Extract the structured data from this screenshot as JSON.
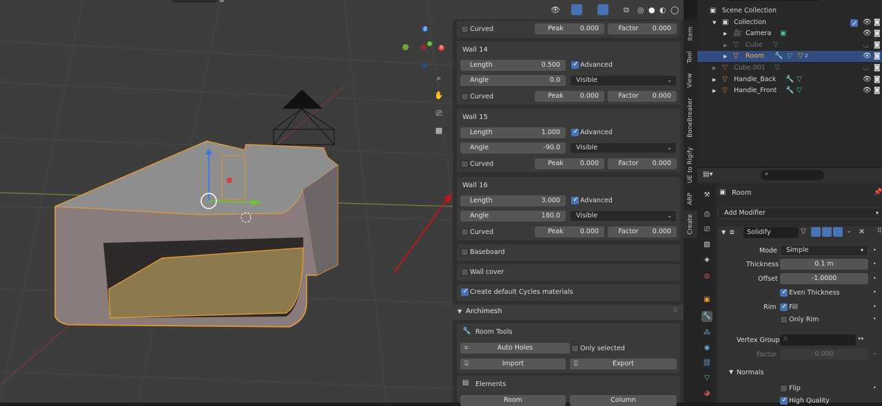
{
  "viewport": {
    "nav_icons": [
      "zoom-icon",
      "hand-pan-icon",
      "camera-view-icon",
      "grid-perspective-icon"
    ]
  },
  "npanel": {
    "top_row": {
      "curved_label": "Curved",
      "peak_label": "Peak",
      "peak_value": "0.000",
      "factor_label": "Factor",
      "factor_value": "0.000"
    },
    "walls": [
      {
        "title": "Wall 14",
        "length_label": "Length",
        "length": "0.500",
        "advanced_label": "Advanced",
        "angle_label": "Angle",
        "angle": "0.0",
        "visible": "Visible",
        "curved_label": "Curved",
        "peak_label": "Peak",
        "peak": "0.000",
        "factor_label": "Factor",
        "factor": "0.000"
      },
      {
        "title": "Wall 15",
        "length_label": "Length",
        "length": "1.000",
        "advanced_label": "Advanced",
        "angle_label": "Angle",
        "angle": "-90.0",
        "visible": "Visible",
        "curved_label": "Curved",
        "peak_label": "Peak",
        "peak": "0.000",
        "factor_label": "Factor",
        "factor": "0.000"
      },
      {
        "title": "Wall 16",
        "length_label": "Length",
        "length": "3.000",
        "advanced_label": "Advanced",
        "angle_label": "Angle",
        "angle": "180.0",
        "visible": "Visible",
        "curved_label": "Curved",
        "peak_label": "Peak",
        "peak": "0.000",
        "factor_label": "Factor",
        "factor": "0.000"
      }
    ],
    "baseboard": "Baseboard",
    "wall_cover": "Wall cover",
    "cycles": "Create default Cycles materials",
    "archimesh": "Archimesh",
    "room_tools": "Room Tools",
    "auto_holes": "Auto Holes",
    "only_selected": "Only selected",
    "import": "Import",
    "export": "Export",
    "elements": "Elements",
    "room": "Room",
    "column": "Column"
  },
  "vtabs": [
    "Item",
    "Tool",
    "View",
    "BoneBreaker",
    "UE to Rigify",
    "ARP",
    "Create"
  ],
  "outliner": {
    "rows": [
      {
        "label": "Scene Collection"
      },
      {
        "label": "Collection"
      },
      {
        "label": "Camera"
      },
      {
        "label": "Cube"
      },
      {
        "label": "Room"
      },
      {
        "label": "Cube.001"
      },
      {
        "label": "Handle_Back"
      },
      {
        "label": "Handle_Front"
      }
    ],
    "modifier_count": "2"
  },
  "properties": {
    "object_name": "Room",
    "add_modifier": "Add Modifier",
    "modifier_name": "Solidify",
    "mode_label": "Mode",
    "mode_value": "Simple",
    "thickness_label": "Thickness",
    "thickness_value": "0.1 m",
    "offset_label": "Offset",
    "offset_value": "-1.0000",
    "even_thickness": "Even Thickness",
    "rim_label": "Rim",
    "fill": "Fill",
    "only_rim": "Only Rim",
    "vertex_group_label": "Vertex Group",
    "factor_label": "Factor",
    "factor_value": "0.000",
    "normals": "Normals",
    "flip": "Flip",
    "high_quality": "High Quality"
  },
  "colors": {
    "accent": "#4772b3",
    "selection_outline": "#f0a030",
    "selected_row": "#334d80"
  }
}
